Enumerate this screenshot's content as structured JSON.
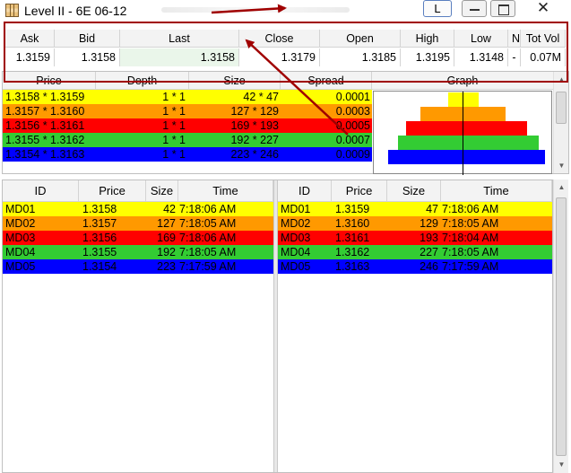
{
  "window": {
    "title": "Level II - 6E 06-12",
    "layout_button": "L",
    "close_glyph": "✕"
  },
  "summary": {
    "headers": [
      "Ask",
      "Bid",
      "Last",
      "Close",
      "Open",
      "High",
      "Low",
      "N",
      "Tot Vol"
    ],
    "values": [
      "1.3159",
      "1.3158",
      "1.3158",
      "1.3179",
      "1.3185",
      "1.3195",
      "1.3148",
      "-",
      "0.07M"
    ]
  },
  "level2": {
    "headers": [
      "Price",
      "Depth",
      "Size",
      "Spread"
    ],
    "graph_header": "Graph",
    "rows": [
      {
        "price": "1.3158 * 1.3159",
        "depth": "1 * 1",
        "size": "42 * 47",
        "spread": "0.0001",
        "color": "#ffff00"
      },
      {
        "price": "1.3157 * 1.3160",
        "depth": "1 * 1",
        "size": "127 * 129",
        "spread": "0.0003",
        "color": "#ff9900"
      },
      {
        "price": "1.3156 * 1.3161",
        "depth": "1 * 1",
        "size": "169 * 193",
        "spread": "0.0005",
        "color": "#ff0000"
      },
      {
        "price": "1.3155 * 1.3162",
        "depth": "1 * 1",
        "size": "192 * 227",
        "spread": "0.0007",
        "color": "#33cc33"
      },
      {
        "price": "1.3154 * 1.3163",
        "depth": "1 * 1",
        "size": "223 * 246",
        "spread": "0.0009",
        "color": "#0000ff"
      }
    ],
    "graph_bars": [
      {
        "bid": 42,
        "ask": 47,
        "color": "#ffff00"
      },
      {
        "bid": 127,
        "ask": 129,
        "color": "#ff9900"
      },
      {
        "bid": 169,
        "ask": 193,
        "color": "#ff0000"
      },
      {
        "bid": 192,
        "ask": 227,
        "color": "#33cc33"
      },
      {
        "bid": 223,
        "ask": 246,
        "color": "#0000ff"
      }
    ]
  },
  "bids": {
    "headers": [
      "ID",
      "Price",
      "Size",
      "Time"
    ],
    "rows": [
      {
        "id": "MD01",
        "price": "1.3158",
        "size": "42",
        "time": "7:18:06 AM",
        "color": "#ffff00"
      },
      {
        "id": "MD02",
        "price": "1.3157",
        "size": "127",
        "time": "7:18:05 AM",
        "color": "#ff9900"
      },
      {
        "id": "MD03",
        "price": "1.3156",
        "size": "169",
        "time": "7:18:06 AM",
        "color": "#ff0000"
      },
      {
        "id": "MD04",
        "price": "1.3155",
        "size": "192",
        "time": "7:18:05 AM",
        "color": "#33cc33"
      },
      {
        "id": "MD05",
        "price": "1.3154",
        "size": "223",
        "time": "7:17:59 AM",
        "color": "#0000ff"
      }
    ]
  },
  "asks": {
    "headers": [
      "ID",
      "Price",
      "Size",
      "Time"
    ],
    "rows": [
      {
        "id": "MD01",
        "price": "1.3159",
        "size": "47",
        "time": "7:18:06 AM",
        "color": "#ffff00"
      },
      {
        "id": "MD02",
        "price": "1.3160",
        "size": "129",
        "time": "7:18:05 AM",
        "color": "#ff9900"
      },
      {
        "id": "MD03",
        "price": "1.3161",
        "size": "193",
        "time": "7:18:04 AM",
        "color": "#ff0000"
      },
      {
        "id": "MD04",
        "price": "1.3162",
        "size": "227",
        "time": "7:18:05 AM",
        "color": "#33cc33"
      },
      {
        "id": "MD05",
        "price": "1.3163",
        "size": "246",
        "time": "7:17:59 AM",
        "color": "#0000ff"
      }
    ]
  },
  "colors": {
    "annotation": "#a00000",
    "last_cell": "#eaf6ea"
  }
}
